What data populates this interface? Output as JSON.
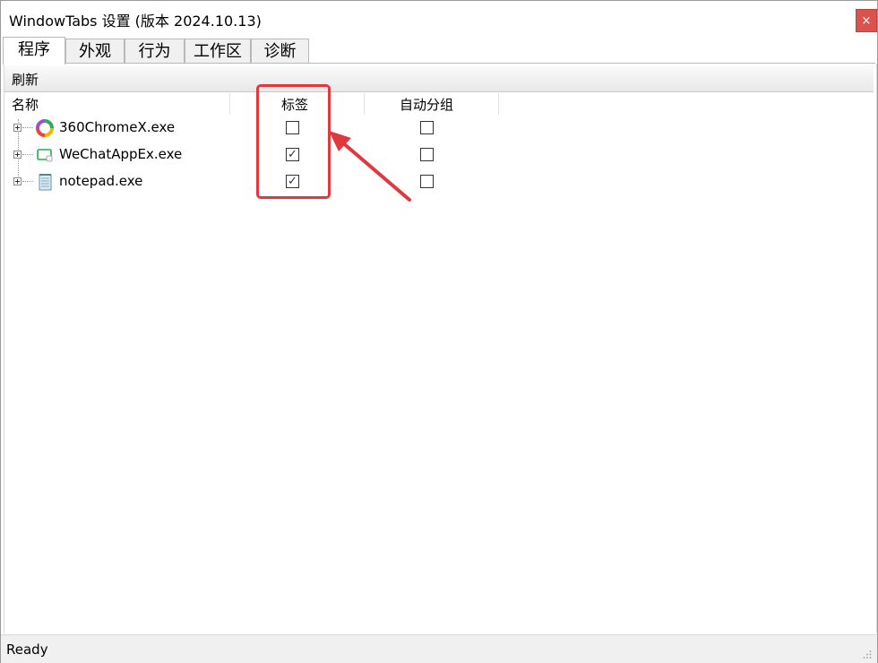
{
  "window": {
    "title": "WindowTabs 设置 (版本 2024.10.13)",
    "close_glyph": "×"
  },
  "tabs": [
    {
      "label": "程序",
      "active": true
    },
    {
      "label": "外观",
      "active": false
    },
    {
      "label": "行为",
      "active": false
    },
    {
      "label": "工作区",
      "active": false
    },
    {
      "label": "诊断",
      "active": false
    }
  ],
  "toolbar": {
    "refresh_label": "刷新"
  },
  "columns": {
    "name": "名称",
    "tabs": "标签",
    "auto_group": "自动分组"
  },
  "rows": [
    {
      "name": "360ChromeX.exe",
      "icon": "360chrome-icon",
      "tabs_checked": false,
      "auto_group_checked": false
    },
    {
      "name": "WeChatAppEx.exe",
      "icon": "wechat-app-icon",
      "tabs_checked": true,
      "auto_group_checked": false
    },
    {
      "name": "notepad.exe",
      "icon": "notepad-icon",
      "tabs_checked": true,
      "auto_group_checked": false
    }
  ],
  "check_glyph": "✓",
  "status": {
    "text": "Ready"
  },
  "annotation": {
    "color": "#e0383f"
  }
}
